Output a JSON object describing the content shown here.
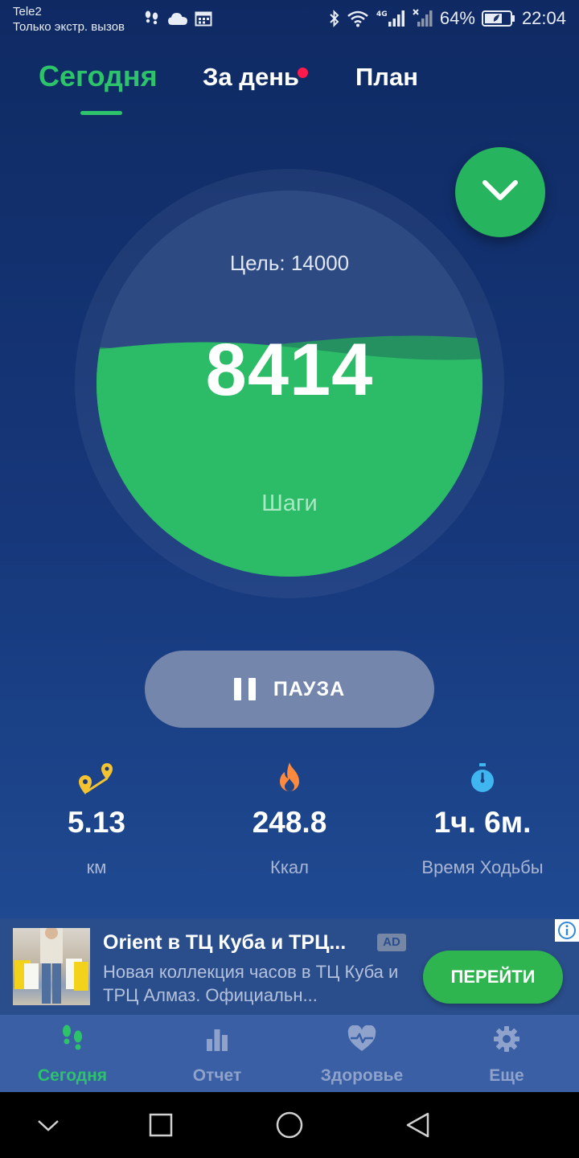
{
  "status_bar": {
    "carrier": "Tele2",
    "carrier_note": "Только экстр. вызов",
    "battery": "64%",
    "time": "22:04",
    "network": "4G"
  },
  "tabs": [
    {
      "label": "Сегодня",
      "active": true
    },
    {
      "label": "За день",
      "active": false,
      "has_notification_dot": true
    },
    {
      "label": "План",
      "active": false
    }
  ],
  "main": {
    "goal_label": "Цель: 14000",
    "steps": "8414",
    "steps_label": "Шаги",
    "goal_progress": 0.601,
    "collapse_icon": "chevron-down-icon"
  },
  "pause_button": {
    "label": "ПАУЗА",
    "icon": "pause-icon"
  },
  "stats": [
    {
      "value": "5.13",
      "label": "км",
      "icon": "distance-pins-icon"
    },
    {
      "value": "248.8",
      "label": "Ккал",
      "icon": "flame-icon"
    },
    {
      "value": "1ч. 6м.",
      "label": "Время Ходьбы",
      "icon": "stopwatch-icon"
    }
  ],
  "ad": {
    "title": "Orient в ТЦ Куба и ТРЦ...",
    "badge": "AD",
    "description": "Новая коллекция часов в ТЦ Куба и ТРЦ Алмаз. Официальн...",
    "cta": "ПЕРЕЙТИ"
  },
  "bottom_nav": [
    {
      "label": "Сегодня",
      "icon": "footsteps-icon",
      "active": true
    },
    {
      "label": "Отчет",
      "icon": "bar-chart-icon",
      "active": false
    },
    {
      "label": "Здоровье",
      "icon": "heart-pulse-icon",
      "active": false
    },
    {
      "label": "Еще",
      "icon": "gear-icon",
      "active": false
    }
  ],
  "colors": {
    "accent": "#2cc36b",
    "background_top": "#0f2a63",
    "background_bottom": "#23539d",
    "notification": "#ff1a4b",
    "water_fill": "#2cbc67"
  }
}
